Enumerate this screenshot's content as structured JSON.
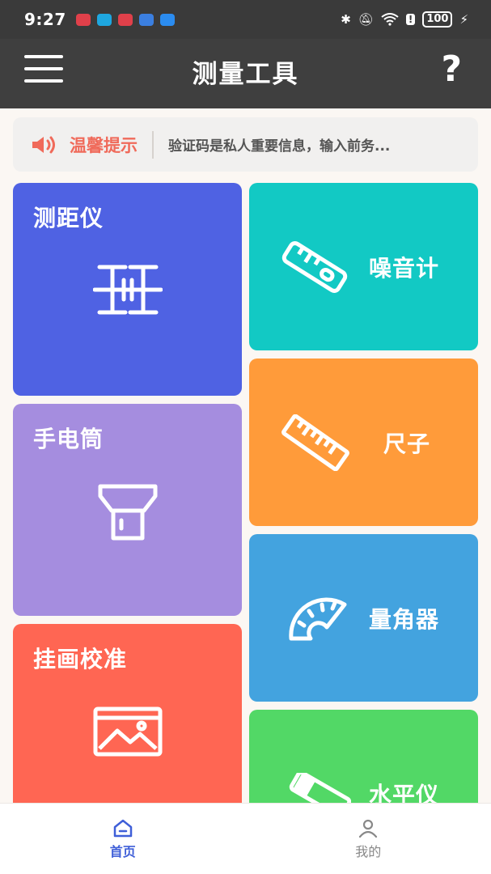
{
  "status_bar": {
    "time": "9:27",
    "battery": "100",
    "notifications": [
      "huawei-icon",
      "browser-icon",
      "huawei-icon",
      "globe-icon",
      "cloud-icon"
    ]
  },
  "app_bar": {
    "title": "测量工具",
    "help": "?"
  },
  "notice": {
    "title": "温馨提示",
    "text": "验证码是私人重要信息，输入前务...",
    "accent": "#f06a5a"
  },
  "tiles": {
    "rangefinder": {
      "label": "测距仪",
      "color": "#4f62e3",
      "icon": "rangefinder-icon"
    },
    "flashlight": {
      "label": "手电筒",
      "color": "#a58ddf",
      "icon": "flashlight-icon"
    },
    "picture": {
      "label": "挂画校准",
      "color": "#ff6653",
      "icon": "picture-frame-icon"
    },
    "noise": {
      "label": "噪音计",
      "color": "#12c9c4",
      "icon": "level-ruler-icon"
    },
    "ruler": {
      "label": "尺子",
      "color": "#ff9b3a",
      "icon": "ruler-icon"
    },
    "protractor": {
      "label": "量角器",
      "color": "#43a3df",
      "icon": "protractor-icon"
    },
    "level": {
      "label": "水平仪",
      "color": "#52d866",
      "icon": "spirit-level-icon"
    }
  },
  "bottom_nav": {
    "items": [
      {
        "label": "首页",
        "icon": "home-icon",
        "active": true
      },
      {
        "label": "我的",
        "icon": "user-icon",
        "active": false
      }
    ],
    "active_color": "#3f5fd8"
  }
}
